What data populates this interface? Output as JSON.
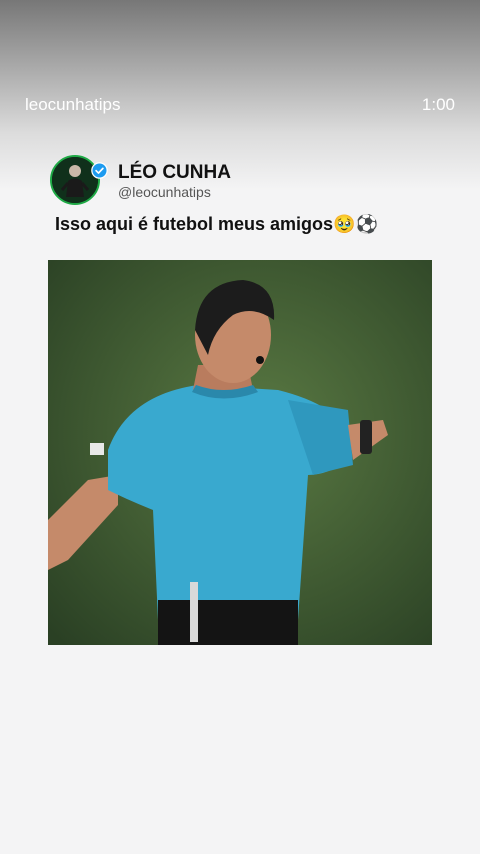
{
  "story": {
    "account": "leocunhatips",
    "duration": "1:00"
  },
  "post": {
    "display_name": "LÉO CUNHA",
    "handle": "@leocunhatips",
    "caption": "Isso aqui é futebol meus amigos🥹⚽",
    "verified_icon": "verified-badge-icon",
    "media_icon": "referee-video-frame"
  },
  "colors": {
    "verified": "#1d9bf0",
    "avatar_ring": "#1faa46",
    "pitch": "#3d5a31",
    "shirt": "#39a9cf"
  }
}
